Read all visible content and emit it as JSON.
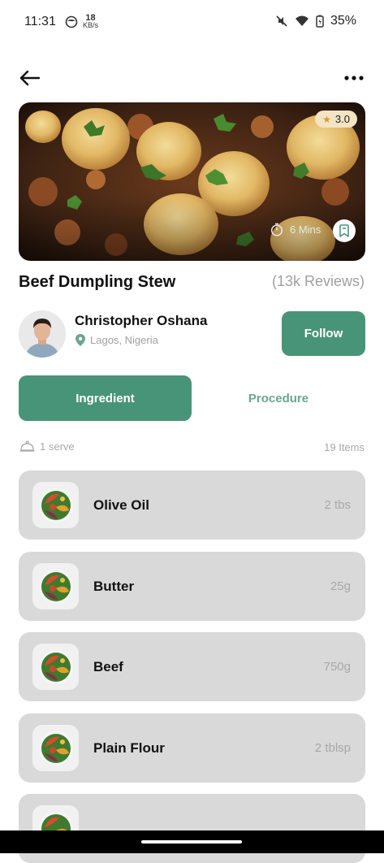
{
  "status_bar": {
    "time": "11:31",
    "net_speed_value": "18",
    "net_speed_unit": "KB/s",
    "battery": "35%"
  },
  "recipe": {
    "rating": "3.0",
    "time": "6 Mins",
    "title": "Beef Dumpling Stew",
    "reviews": "(13k Reviews)"
  },
  "author": {
    "name": "Christopher Oshana",
    "location": "Lagos, Nigeria",
    "follow_label": "Follow"
  },
  "tabs": [
    {
      "label": "Ingredient",
      "active": true
    },
    {
      "label": "Procedure",
      "active": false
    }
  ],
  "serve": {
    "label": "1 serve",
    "items_count": "19 Items"
  },
  "ingredients": [
    {
      "name": "Olive Oil",
      "qty": "2 tbs"
    },
    {
      "name": "Butter",
      "qty": "25g"
    },
    {
      "name": "Beef",
      "qty": "750g"
    },
    {
      "name": "Plain Flour",
      "qty": "2 tblsp"
    }
  ],
  "colors": {
    "accent": "#489479",
    "card_bg": "#d9d9d9",
    "muted_text": "#a8a8a8",
    "rating_bg": "#f3e4c3"
  },
  "icons": [
    "back-arrow-icon",
    "more-icon",
    "star-icon",
    "timer-icon",
    "bookmark-icon",
    "location-pin-icon",
    "cloche-icon",
    "ingredient-bowl-icon"
  ]
}
